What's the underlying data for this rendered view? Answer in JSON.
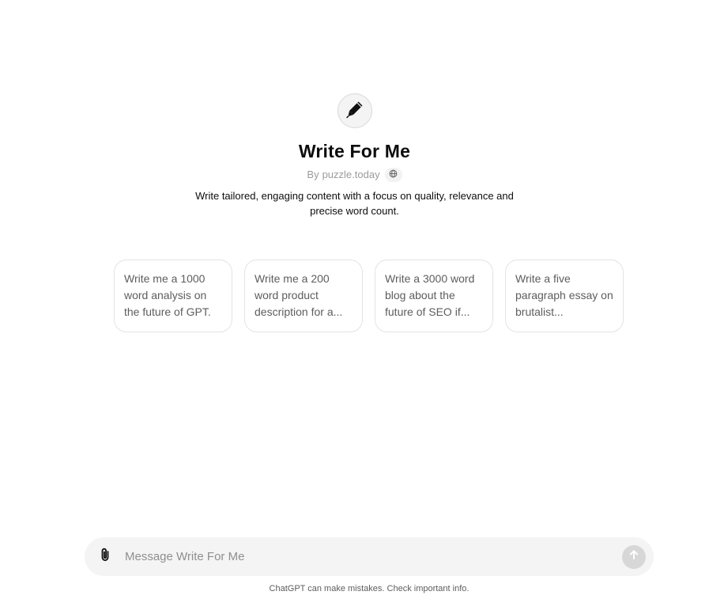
{
  "gpt": {
    "icon": "pen-icon",
    "title": "Write For Me",
    "byline_prefix": "By",
    "author": "puzzle.today",
    "byline_badge_icon": "globe-icon",
    "description": "Write tailored, engaging content with a focus on quality, relevance and precise word count."
  },
  "suggestions": [
    {
      "text": "Write me a 1000 word analysis on the future of GPT."
    },
    {
      "text": "Write me a 200 word product description for a..."
    },
    {
      "text": "Write a 3000 word blog about the future of SEO if..."
    },
    {
      "text": "Write a five paragraph essay on brutalist..."
    }
  ],
  "composer": {
    "placeholder": "Message Write For Me",
    "value": "",
    "attach_icon": "paperclip-icon",
    "send_icon": "arrow-up-icon"
  },
  "footer": {
    "disclaimer": "ChatGPT can make mistakes. Check important info."
  },
  "colors": {
    "background": "#ffffff",
    "composer_bg": "#f4f4f4",
    "send_disabled": "#d7d7d7",
    "muted_text": "#9b9b9b"
  }
}
